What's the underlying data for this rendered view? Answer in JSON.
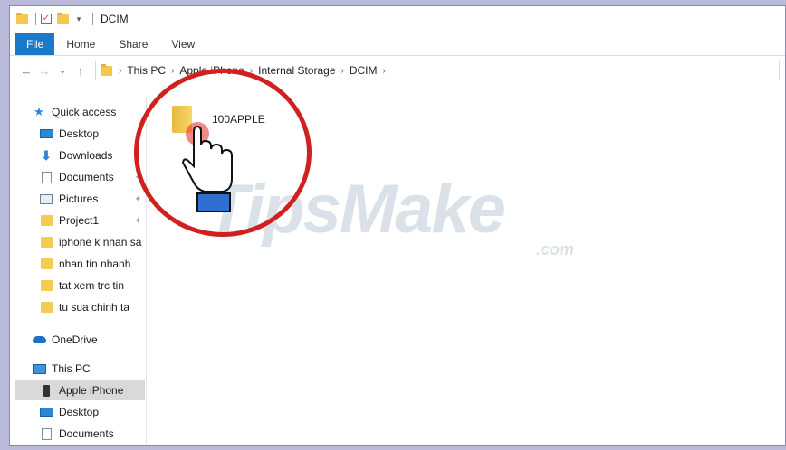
{
  "window": {
    "title": "DCIM",
    "quick_access_toolbar_icons": [
      "folder-icon",
      "properties-icon",
      "new-folder-icon",
      "customize-dropdown-icon"
    ]
  },
  "ribbon": {
    "tabs": [
      {
        "label": "File"
      },
      {
        "label": "Home"
      },
      {
        "label": "Share"
      },
      {
        "label": "View"
      }
    ]
  },
  "address": {
    "crumbs": [
      "This PC",
      "Apple iPhone",
      "Internal Storage",
      "DCIM"
    ]
  },
  "navpane": {
    "quick_access": "Quick access",
    "pinned": [
      "Desktop",
      "Downloads",
      "Documents",
      "Pictures",
      "Project1"
    ],
    "folders": [
      "iphone k nhan sa",
      "nhan tin nhanh",
      "tat xem trc tin",
      "tu sua chinh ta"
    ],
    "onedrive": "OneDrive",
    "this_pc": "This PC",
    "this_pc_items": [
      "Apple iPhone",
      "Desktop",
      "Documents"
    ]
  },
  "content": {
    "items": [
      {
        "name": "100APPLE"
      }
    ]
  },
  "watermark": {
    "brand": "TipsMake",
    "suffix": ".com"
  },
  "colors": {
    "file_tab": "#1979ca",
    "highlight_circle": "#d02020",
    "folder": "#f4cc55"
  }
}
